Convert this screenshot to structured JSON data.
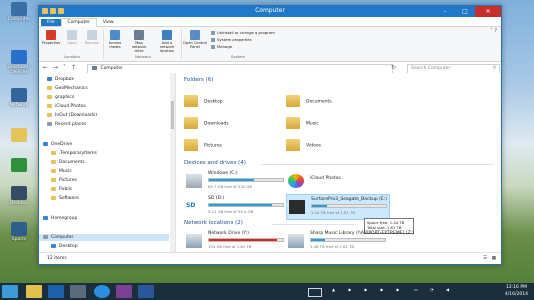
{
  "desktop": {
    "icons": [
      "Computer",
      "Bluetooth Devices",
      "Network",
      "",
      "",
      "Desktop",
      "Sports"
    ]
  },
  "window": {
    "title": "Computer",
    "tabs": [
      "File",
      "Computer",
      "View"
    ],
    "ribbon": {
      "location": {
        "label": "Location",
        "buttons": [
          "Properties",
          "Open",
          "Rename"
        ]
      },
      "network": {
        "label": "Network",
        "buttons": [
          "Access media",
          "Map network drive",
          "Add a network location"
        ]
      },
      "system": {
        "label": "System",
        "open_control_panel": "Open Control Panel",
        "links": [
          "Uninstall or change a program",
          "System properties",
          "Manage"
        ]
      }
    },
    "address": {
      "path": "Computer",
      "search_placeholder": "Search Computer"
    },
    "nav_pane": {
      "items": [
        "Dropbox",
        "GeoMechanics",
        "graphics",
        "iCloud Photos",
        "InOut (Downloads)",
        "Recent places",
        "OneDrive",
        ".TemporaryItems",
        "Documents",
        "Music",
        "Pictures",
        "Public",
        "Software",
        "Homegroup",
        "Computer",
        "Desktop"
      ]
    },
    "folders_section": "Folders (6)",
    "folders": [
      "Desktop",
      "Documents",
      "Downloads",
      "Music",
      "Pictures",
      "Videos"
    ],
    "devices_section": "Devices and drives (4)",
    "drives": [
      {
        "name": "Windows (C:)",
        "free": "89.7 GB free of 232 GB",
        "fill": 0.61
      },
      {
        "name": "iCloud Photos",
        "free": "",
        "fill": null
      },
      {
        "name": "SD (D:)",
        "free": "9.11 GB free of 59.4 GB",
        "fill": 0.85
      },
      {
        "name": "SurfacePro3_Seagate_Backup (E:)",
        "free": "1.44 TB free of 1.81 TB",
        "fill": 0.2
      }
    ],
    "tooltip": [
      "Space free: 1.44 TB",
      "Total size: 1.81 TB"
    ],
    "network_section": "Network locations (2)",
    "network_drives": [
      {
        "name": "Network Drive (Y:)",
        "free": "155 GB free of 1.81 TB",
        "fill": 0.92
      },
      {
        "name": "Sharp Music Library (\\\\AIRPORT-EXTREME) (Z:)",
        "free": "1.46 TB free of 1.81 TB",
        "fill": 0.19
      }
    ],
    "status": "12 items"
  },
  "taskbar": {
    "time": "12:16 PM",
    "date": "4/16/2014"
  },
  "colors": {
    "accent": "#1f78c8",
    "bar": "#26a0da",
    "bar_full": "#da2626"
  }
}
